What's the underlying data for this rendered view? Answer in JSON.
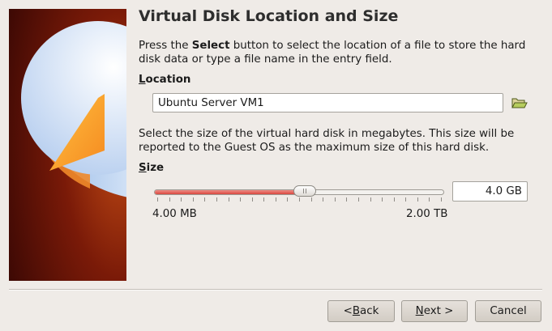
{
  "header": {
    "title": "Virtual Disk Location and Size"
  },
  "intro": {
    "pre": "Press the ",
    "bold": "Select",
    "post": " button to select the location of a file to store the hard",
    "line2": "disk data or type a file name in the entry field."
  },
  "location": {
    "mnemonic": "L",
    "label_rest": "ocation",
    "value": "Ubuntu Server VM1",
    "folder_icon": "folder-open-icon"
  },
  "size_desc": {
    "line1": "Select the size of the virtual hard disk in megabytes. This size will be",
    "line2": "reported to the Guest OS as the maximum size of this hard disk."
  },
  "size": {
    "mnemonic": "S",
    "label_rest": "ize",
    "value": "4.0 GB",
    "slider_fraction": 0.52,
    "tick_count": 25,
    "min_label": "4.00 MB",
    "max_label": "2.00 TB"
  },
  "buttons": {
    "back_pre": "< ",
    "back_mnemonic": "B",
    "back_rest": "ack",
    "next_mnemonic": "N",
    "next_rest": "ext >",
    "cancel": "Cancel"
  }
}
